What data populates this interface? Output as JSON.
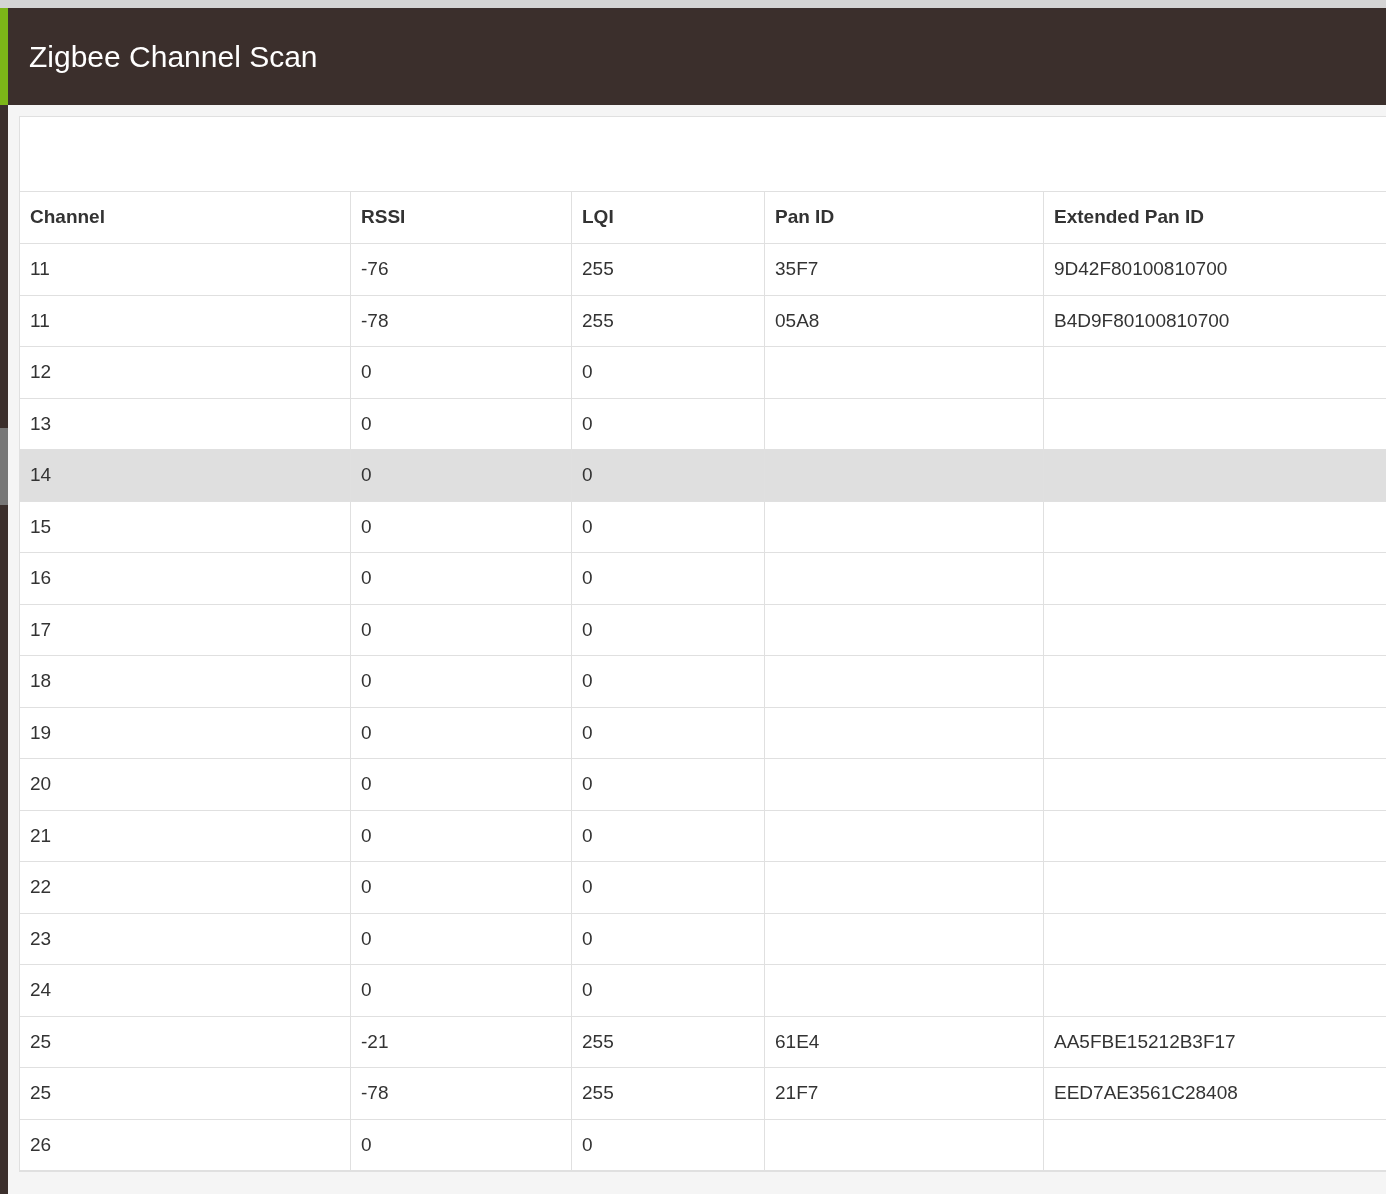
{
  "header": {
    "title": "Zigbee Channel Scan"
  },
  "table": {
    "columns": [
      "Channel",
      "RSSI",
      "LQI",
      "Pan ID",
      "Extended Pan ID"
    ],
    "rows": [
      {
        "cells": [
          "11",
          "-76",
          "255",
          "35F7",
          "9D42F80100810700"
        ],
        "selected": false
      },
      {
        "cells": [
          "11",
          "-78",
          "255",
          "05A8",
          "B4D9F80100810700"
        ],
        "selected": false
      },
      {
        "cells": [
          "12",
          "0",
          "0",
          "",
          ""
        ],
        "selected": false
      },
      {
        "cells": [
          "13",
          "0",
          "0",
          "",
          ""
        ],
        "selected": false
      },
      {
        "cells": [
          "14",
          "0",
          "0",
          "",
          ""
        ],
        "selected": true
      },
      {
        "cells": [
          "15",
          "0",
          "0",
          "",
          ""
        ],
        "selected": false
      },
      {
        "cells": [
          "16",
          "0",
          "0",
          "",
          ""
        ],
        "selected": false
      },
      {
        "cells": [
          "17",
          "0",
          "0",
          "",
          ""
        ],
        "selected": false
      },
      {
        "cells": [
          "18",
          "0",
          "0",
          "",
          ""
        ],
        "selected": false
      },
      {
        "cells": [
          "19",
          "0",
          "0",
          "",
          ""
        ],
        "selected": false
      },
      {
        "cells": [
          "20",
          "0",
          "0",
          "",
          ""
        ],
        "selected": false
      },
      {
        "cells": [
          "21",
          "0",
          "0",
          "",
          ""
        ],
        "selected": false
      },
      {
        "cells": [
          "22",
          "0",
          "0",
          "",
          ""
        ],
        "selected": false
      },
      {
        "cells": [
          "23",
          "0",
          "0",
          "",
          ""
        ],
        "selected": false
      },
      {
        "cells": [
          "24",
          "0",
          "0",
          "",
          ""
        ],
        "selected": false
      },
      {
        "cells": [
          "25",
          "-21",
          "255",
          "61E4",
          "AA5FBE15212B3F17"
        ],
        "selected": false
      },
      {
        "cells": [
          "25",
          "-78",
          "255",
          "21F7",
          "EED7AE3561C28408"
        ],
        "selected": false
      },
      {
        "cells": [
          "26",
          "0",
          "0",
          "",
          ""
        ],
        "selected": false
      }
    ]
  }
}
